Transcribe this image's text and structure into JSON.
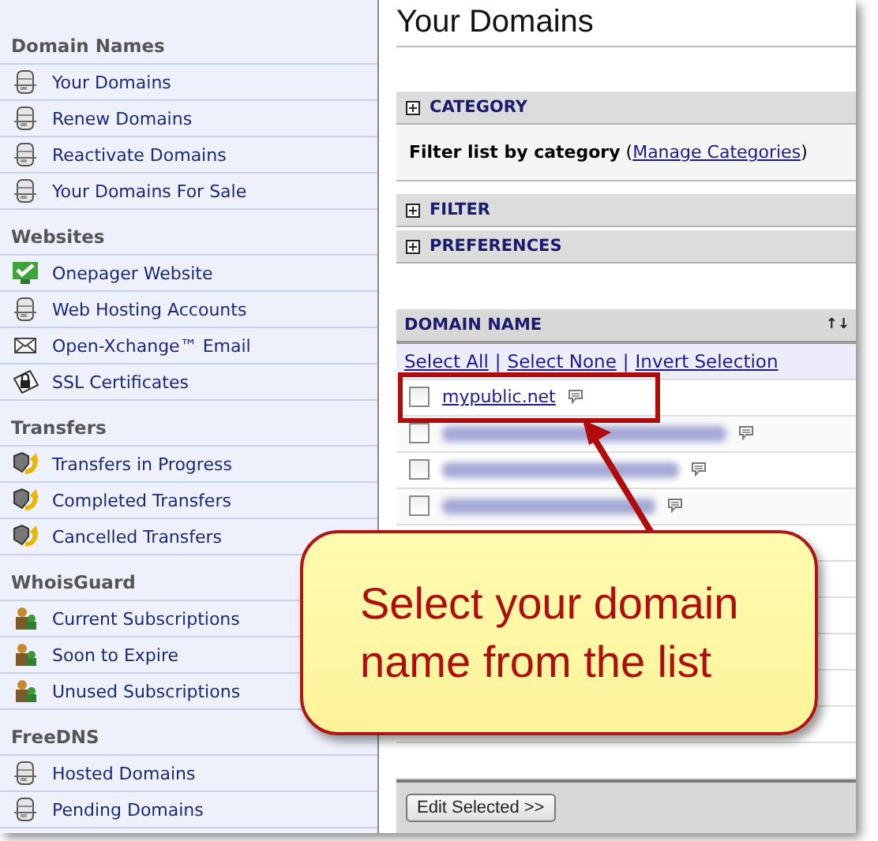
{
  "sidebar": {
    "sections": [
      {
        "heading": "Domain Names",
        "items": [
          {
            "label": "Your Domains",
            "kind": "server"
          },
          {
            "label": "Renew Domains",
            "kind": "server"
          },
          {
            "label": "Reactivate Domains",
            "kind": "server"
          },
          {
            "label": "Your Domains For Sale",
            "kind": "server"
          }
        ]
      },
      {
        "heading": "Websites",
        "items": [
          {
            "label": "Onepager Website",
            "kind": "monitor"
          },
          {
            "label": "Web Hosting Accounts",
            "kind": "server"
          },
          {
            "label": "Open-Xchange™ Email",
            "kind": "mail"
          },
          {
            "label": "SSL Certificates",
            "kind": "lock"
          }
        ]
      },
      {
        "heading": "Transfers",
        "items": [
          {
            "label": "Transfers in Progress",
            "kind": "transfer"
          },
          {
            "label": "Completed Transfers",
            "kind": "transfer"
          },
          {
            "label": "Cancelled Transfers",
            "kind": "transfer"
          }
        ]
      },
      {
        "heading": "WhoisGuard",
        "items": [
          {
            "label": "Current Subscriptions",
            "kind": "guard"
          },
          {
            "label": "Soon to Expire",
            "kind": "guard"
          },
          {
            "label": "Unused Subscriptions",
            "kind": "guard"
          }
        ]
      },
      {
        "heading": "FreeDNS",
        "items": [
          {
            "label": "Hosted Domains",
            "kind": "server"
          },
          {
            "label": "Pending Domains",
            "kind": "server"
          }
        ]
      }
    ]
  },
  "main": {
    "title": "Your Domains",
    "panels": [
      {
        "label": "CATEGORY",
        "description_start": "**Filter list by category** (",
        "link": "Manage Categories",
        "description_end": ")"
      },
      {
        "label": "FILTER"
      },
      {
        "label": "PREFERENCES"
      }
    ],
    "table": {
      "column": "DOMAIN NAME",
      "sort_icon": "↑↓",
      "select_links": [
        "Select All",
        "Select None",
        "Invert Selection"
      ],
      "link_separator": "|",
      "rows": [
        {
          "kind": "domain",
          "name": "mypublic.net",
          "checked": false
        },
        {
          "kind": "redacted",
          "checked": false
        },
        {
          "kind": "redacted",
          "checked": false
        },
        {
          "kind": "redacted",
          "checked": false
        }
      ],
      "button": "Edit Selected >>"
    }
  },
  "callout": {
    "text": "Select your domain name from the list"
  }
}
